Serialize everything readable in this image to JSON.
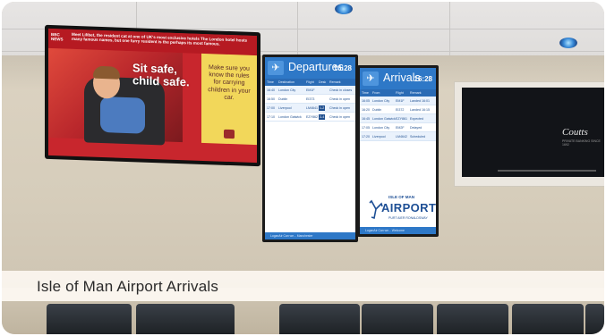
{
  "caption": "Isle of Man Airport Arrivals",
  "ad": {
    "bbc": "BBC NEWS",
    "headline": "Meet Lilibet, the resident cat at one of UK's most exclusive hotels The London hotel hosts many famous names, but one furry resident is the perhaps its most famous.",
    "main_text": "Sit safe, child safe.",
    "side_text": "Make sure you know the rules for carrying children in your car."
  },
  "departures": {
    "title": "Departures",
    "clock": "16:28",
    "columns": [
      "Time",
      "Destination",
      "Flight",
      "Desk",
      "Remark"
    ],
    "rows": [
      {
        "time": "16:40",
        "dest": "London City",
        "flight": "EM1F",
        "desk": "",
        "remark": "Check in closes"
      },
      {
        "time": "16:50",
        "dest": "Dublin",
        "flight": "EI373",
        "desk": "",
        "remark": "Check in open"
      },
      {
        "time": "17:00",
        "dest": "Liverpool",
        "flight": "LM4641",
        "desk": "1-2",
        "remark": "Check in open"
      },
      {
        "time": "17:10",
        "dest": "London Gatwick",
        "flight": "EZY862",
        "desk": "3-4",
        "remark": "Check in open"
      }
    ],
    "footer": "LoganAir    Can we... Manchester"
  },
  "arrivals": {
    "title": "Arrivals",
    "clock": "16:28",
    "columns": [
      "Time",
      "From",
      "Flight",
      "Remark"
    ],
    "rows": [
      {
        "time": "16:05",
        "from": "London City",
        "flight": "EM1F",
        "remark": "Landed 16:01"
      },
      {
        "time": "16:20",
        "from": "Dublin",
        "flight": "EI372",
        "remark": "Landed 16:15"
      },
      {
        "time": "16:45",
        "from": "London Gatwick",
        "flight": "EZY861",
        "remark": "Expected"
      },
      {
        "time": "17:05",
        "from": "London City",
        "flight": "EM2F",
        "remark": "Delayed"
      },
      {
        "time": "17:20",
        "from": "Liverpool",
        "flight": "LM4642",
        "remark": "Scheduled"
      }
    ],
    "footer": "LoganAir    Can we... Welcome",
    "logo_small": "ISLE OF MAN",
    "logo_big": "AIRPORT",
    "logo_sub": "PURT AIER RONALDSWAY"
  },
  "coutts": {
    "logo": "Coutts",
    "sub": "PRIVATE BANKING SINCE 1692"
  }
}
